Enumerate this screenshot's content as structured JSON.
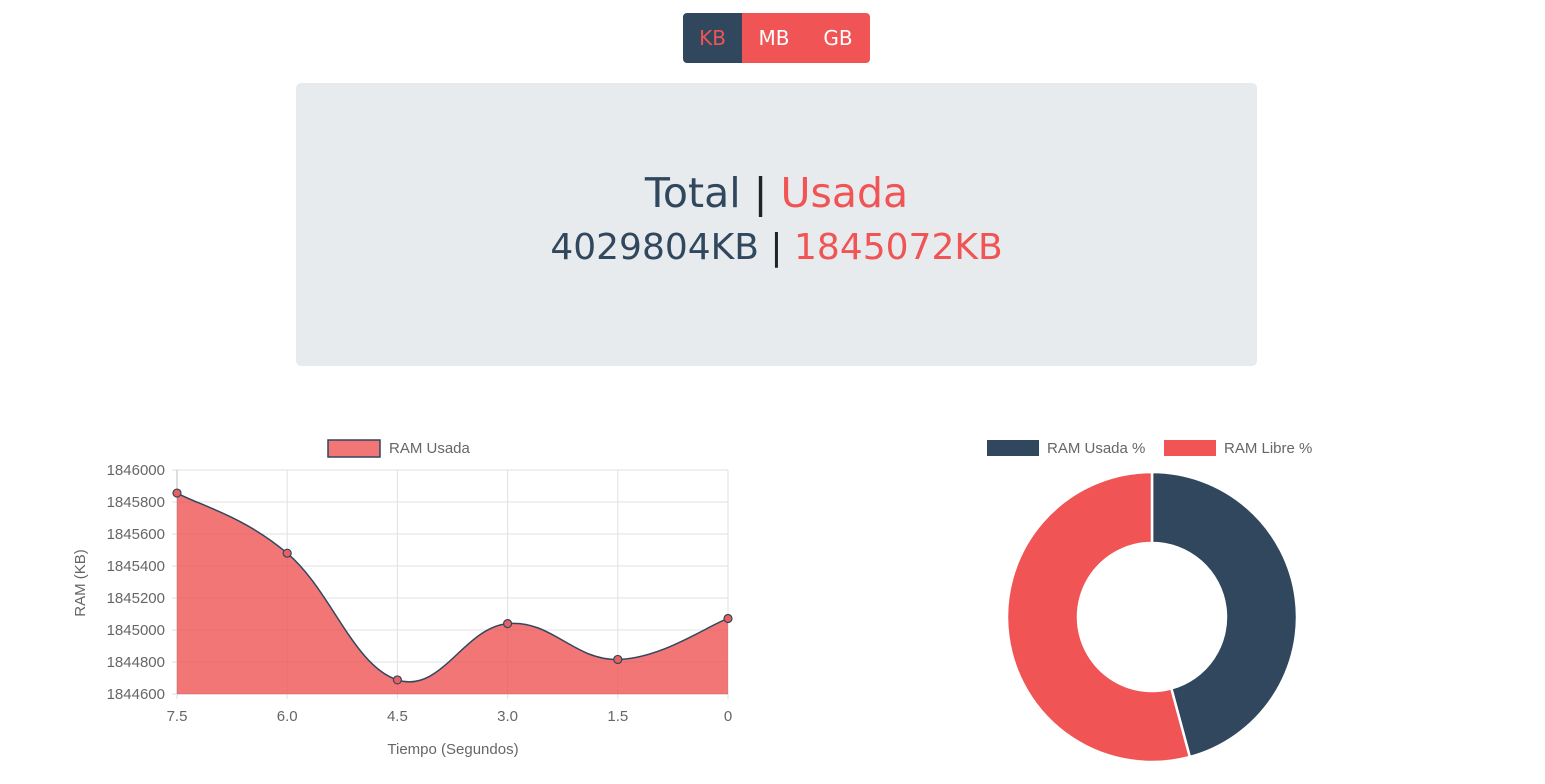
{
  "units": {
    "options": [
      "KB",
      "MB",
      "GB"
    ],
    "selected": "KB"
  },
  "summary": {
    "total_label": "Total",
    "separator": "|",
    "used_label": "Usada",
    "total_value": "4029804KB",
    "used_value": "1845072KB"
  },
  "colors": {
    "dark": "#30475e",
    "red": "#f05454",
    "panel": "#e8ebee"
  },
  "chart_data": [
    {
      "type": "area",
      "title": "",
      "xlabel": "Tiempo (Segundos)",
      "ylabel": "RAM (KB)",
      "x": [
        "7.5",
        "6.0",
        "4.5",
        "3.0",
        "1.5",
        "0"
      ],
      "series": [
        {
          "name": "RAM Usada",
          "values": [
            1845856,
            1845480,
            1844688,
            1845040,
            1844816,
            1845072
          ]
        }
      ],
      "yticks": [
        1846000,
        1845800,
        1845600,
        1845400,
        1845200,
        1845000,
        1844800,
        1844600
      ],
      "ylim": [
        1844600,
        1846000
      ],
      "grid": true,
      "legend": "top"
    },
    {
      "type": "pie",
      "donut": true,
      "title": "",
      "series": [
        {
          "name": "RAM Usada %",
          "value": 45.8
        },
        {
          "name": "RAM Libre %",
          "value": 54.2
        }
      ],
      "legend": "top"
    }
  ]
}
